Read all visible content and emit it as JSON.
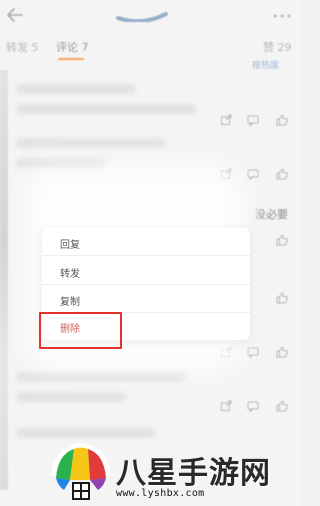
{
  "tabs": {
    "repost": "转发 5",
    "comments": "评论 7",
    "likes": "赞 29"
  },
  "sort_label": "按热度",
  "side_text": "没必要",
  "context_menu": {
    "items": [
      "回复",
      "转发",
      "复制",
      "删除"
    ],
    "highlighted_item": "删除",
    "highlight_color": "#e5312b"
  },
  "watermark": {
    "title": "八星手游网",
    "url": "www.lyshbx.com"
  },
  "colors": {
    "tab_underline": "#f3a35c",
    "delete_text": "#d8625a"
  },
  "icons": [
    "back-arrow-icon",
    "more-dots-icon",
    "share-icon",
    "comment-icon",
    "like-icon"
  ]
}
